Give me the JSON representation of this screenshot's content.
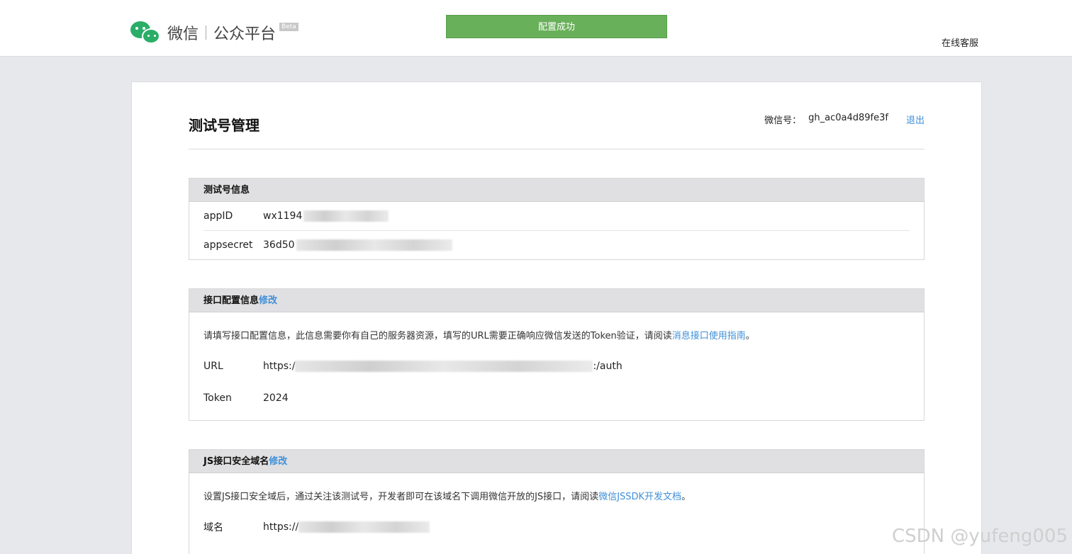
{
  "header": {
    "logo_name": "微信",
    "logo_platform": "公众平台",
    "beta": "Beta",
    "toast": "配置成功",
    "service": "在线客服"
  },
  "page": {
    "title": "测试号管理",
    "account_label": "微信号：",
    "account_id": "gh_ac0a4d89fe3f",
    "logout": "退出"
  },
  "test_info": {
    "heading": "测试号信息",
    "appid_label": "appID",
    "appid_value": "wx1194",
    "appsecret_label": "appsecret",
    "appsecret_value": "36d50"
  },
  "api_config": {
    "heading": "接口配置信息",
    "edit": "修改",
    "description": "请填写接口配置信息，此信息需要你有自己的服务器资源，填写的URL需要正确响应微信发送的Token验证，请阅读",
    "link": "消息接口使用指南",
    "period": "。",
    "url_label": "URL",
    "url_prefix": "https:/",
    "url_suffix": ":/auth",
    "token_label": "Token",
    "token_value": "2024"
  },
  "js_domain": {
    "heading": "JS接口安全域名",
    "edit": "修改",
    "description": "设置JS接口安全域后，通过关注该测试号，开发者即可在该域名下调用微信开放的JS接口，请阅读",
    "link": "微信JSSDK开发文档",
    "period": "。",
    "domain_label": "域名",
    "domain_prefix": "https://"
  },
  "watermark": "CSDN @yufeng005"
}
